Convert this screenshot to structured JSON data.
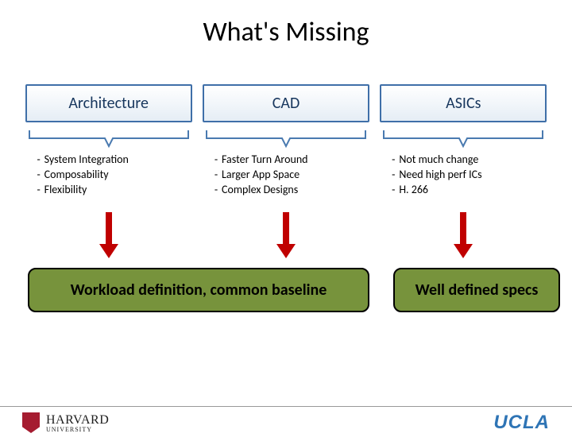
{
  "title": "What's Missing",
  "columns": [
    {
      "heading": "Architecture",
      "items": [
        "System Integration",
        "Composability",
        "Flexibility"
      ]
    },
    {
      "heading": "CAD",
      "items": [
        "Faster Turn Around",
        "Larger App Space",
        "Complex Designs"
      ]
    },
    {
      "heading": "ASICs",
      "items": [
        "Not much change",
        "Need high perf ICs",
        "H. 266"
      ]
    }
  ],
  "bottom": {
    "left": "Workload definition, common baseline",
    "right": "Well defined specs"
  },
  "footer": {
    "harvard": "HARVARD",
    "harvard_sub": "UNIVERSITY",
    "ucla": "UCLA"
  }
}
